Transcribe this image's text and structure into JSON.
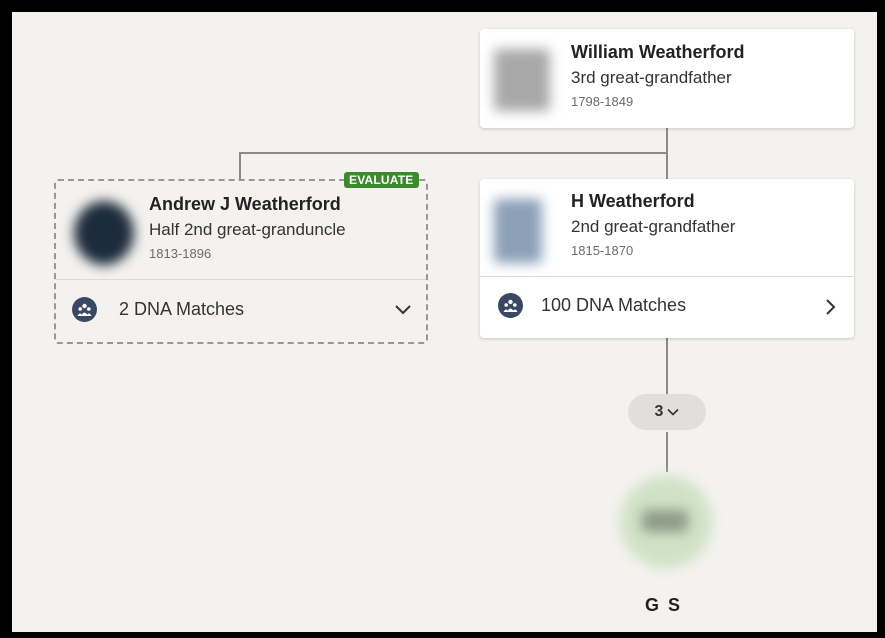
{
  "william": {
    "name": "William Weatherford",
    "relationship": "3rd great-grandfather",
    "dates": "1798-1849"
  },
  "andrew": {
    "badge": "EVALUATE",
    "name": "Andrew J Weatherford",
    "relationship": "Half 2nd great-granduncle",
    "dates": "1813-1896",
    "dna_matches": "2 DNA Matches"
  },
  "h": {
    "name": "H Weatherford",
    "relationship": "2nd great-grandfather",
    "dates": "1815-1870",
    "dna_matches": "100 DNA Matches"
  },
  "generations_pill": {
    "count": "3"
  },
  "descendant": {
    "initials": "G S"
  },
  "icons": {
    "dna": "people-group-icon",
    "expand": "chevron-down-icon",
    "go": "chevron-right-icon"
  },
  "colors": {
    "background": "#f4f2ef",
    "badge": "#3c8a2e",
    "dna_icon": "#3a4863"
  }
}
